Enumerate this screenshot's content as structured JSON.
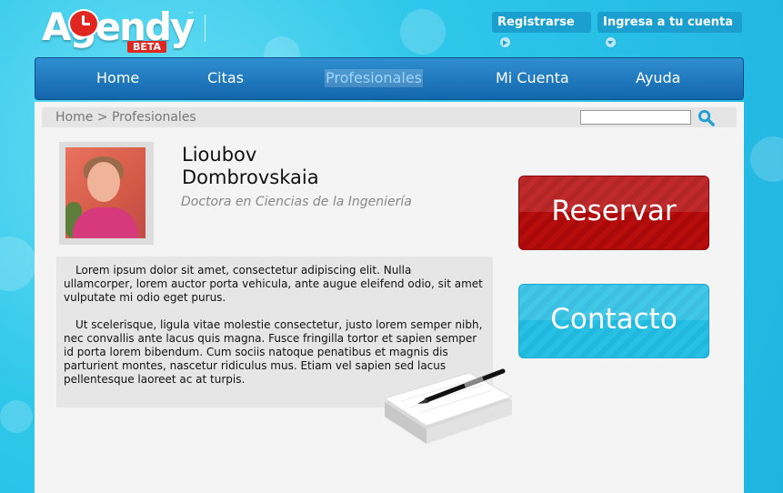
{
  "header": {
    "logo": {
      "text": "Agendy",
      "badge": "BETA",
      "tm": "™"
    },
    "register_label": "Registrarse",
    "login_label": "Ingresa a tu cuenta"
  },
  "nav": {
    "items": [
      {
        "label": "Home"
      },
      {
        "label": "Citas"
      },
      {
        "label": "Profesionales",
        "active": true
      },
      {
        "label": "Mi Cuenta"
      },
      {
        "label": "Ayuda"
      }
    ]
  },
  "breadcrumb": "Home > Profesionales",
  "search": {
    "value": ""
  },
  "profile": {
    "first_name": "Lioubov",
    "last_name": "Dombrovskaia",
    "title": "Doctora en Ciencias de la Ingeniería",
    "bio": [
      "Lorem ipsum dolor sit amet, consectetur adipiscing elit. Nulla ullamcorper, lorem auctor porta vehicula, ante augue eleifend odio, sit amet vulputate mi odio eget purus.",
      "Ut scelerisque, ligula vitae molestie consectetur, justo lorem semper nibh, nec convallis ante lacus quis magna. Fusce fringilla tortor et sapien semper id porta lorem bibendum. Cum sociis natoque penatibus et magnis dis parturient montes, nascetur ridiculus mus. Etiam vel sapien sed lacus pellentesque laoreet ac at turpis."
    ]
  },
  "actions": {
    "reserve_label": "Reservar",
    "contact_label": "Contacto"
  },
  "colors": {
    "background": "#2fc7ea",
    "nav": "#1d74b8",
    "reserve": "#b80d0d",
    "contact": "#28c1e4"
  },
  "icons": [
    "search-icon",
    "arrow-right-icon",
    "chevron-down-icon",
    "notepad-pen-icon"
  ]
}
